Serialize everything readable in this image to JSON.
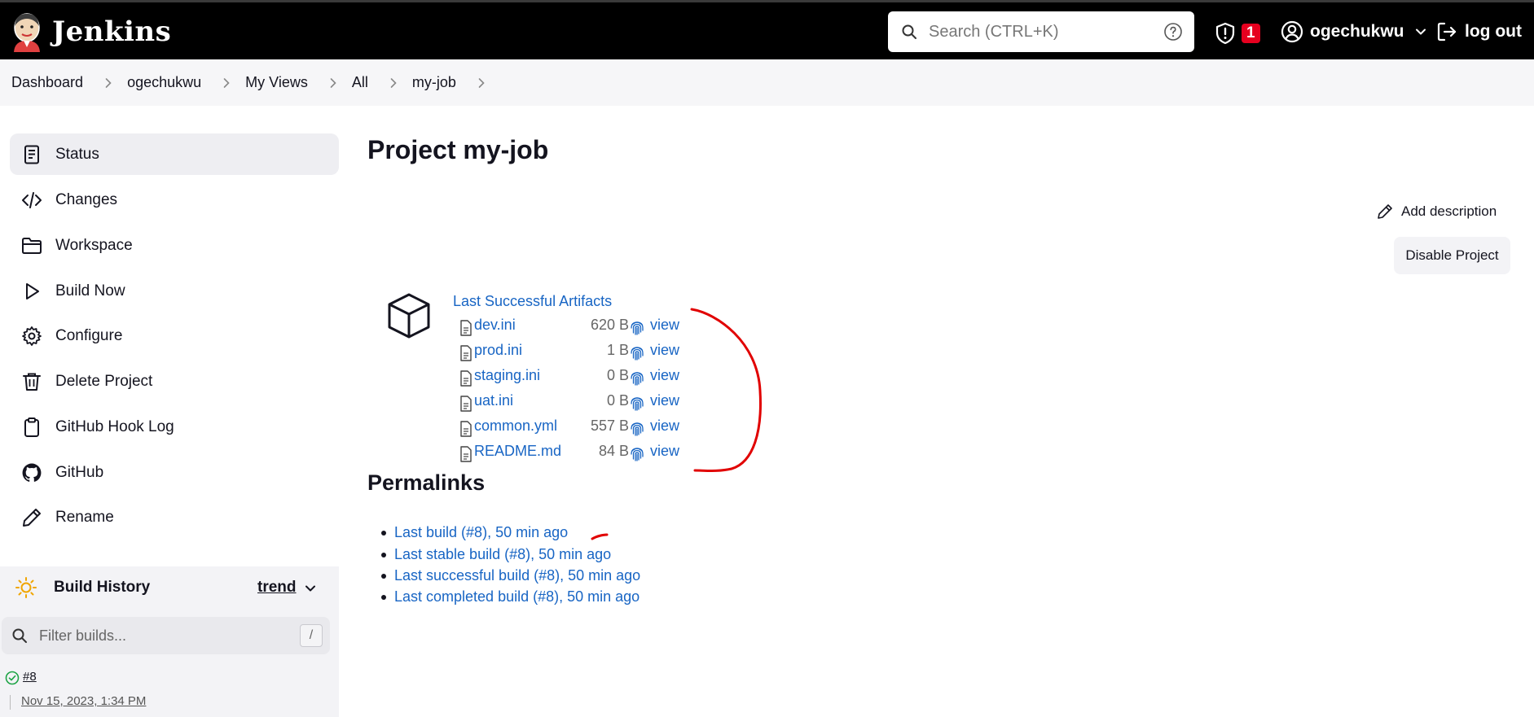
{
  "header": {
    "brand_name": "Jenkins",
    "search_placeholder": "Search (CTRL+K)",
    "security_badge": "1",
    "user_name": "ogechukwu",
    "logout_label": "log out"
  },
  "breadcrumb": [
    "Dashboard",
    "ogechukwu",
    "My Views",
    "All",
    "my-job"
  ],
  "sidebar": {
    "items": [
      {
        "label": "Status",
        "icon": "status-icon"
      },
      {
        "label": "Changes",
        "icon": "code-icon"
      },
      {
        "label": "Workspace",
        "icon": "folder-icon"
      },
      {
        "label": "Build Now",
        "icon": "play-icon"
      },
      {
        "label": "Configure",
        "icon": "gear-icon"
      },
      {
        "label": "Delete Project",
        "icon": "trash-icon"
      },
      {
        "label": "GitHub Hook Log",
        "icon": "clipboard-icon"
      },
      {
        "label": "GitHub",
        "icon": "github-icon"
      },
      {
        "label": "Rename",
        "icon": "pencil-icon"
      }
    ]
  },
  "build_history": {
    "title": "Build History",
    "trend_label": "trend",
    "filter_placeholder": "Filter builds...",
    "filter_shortcut": "/",
    "builds": [
      {
        "number": "#8",
        "date": "Nov 15, 2023, 1:34 PM"
      }
    ]
  },
  "main": {
    "title": "Project my-job",
    "add_description": "Add description",
    "disable_label": "Disable Project",
    "artifacts_title": "Last Successful Artifacts",
    "view_label": "view",
    "artifacts": [
      {
        "name": "dev.ini",
        "size": "620 B"
      },
      {
        "name": "prod.ini",
        "size": "1 B"
      },
      {
        "name": "staging.ini",
        "size": "0 B"
      },
      {
        "name": "uat.ini",
        "size": "0 B"
      },
      {
        "name": "common.yml",
        "size": "557 B"
      },
      {
        "name": "README.md",
        "size": "84 B"
      }
    ],
    "permalinks_title": "Permalinks",
    "permalinks": [
      "Last build (#8), 50 min ago",
      "Last stable build (#8), 50 min ago",
      "Last successful build (#8), 50 min ago",
      "Last completed build (#8), 50 min ago"
    ]
  },
  "colors": {
    "link": "#1865c4",
    "badge": "#e6001f",
    "annotation": "#e10000"
  }
}
